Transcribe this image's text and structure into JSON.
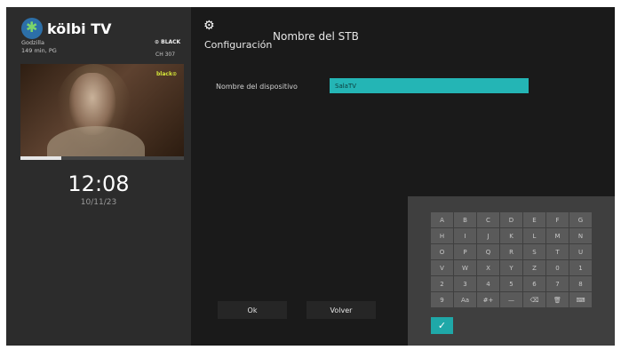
{
  "colors": {
    "accent": "#24b5b5",
    "panel": "#2c2c2c",
    "background": "#1a1a1a"
  },
  "brand": {
    "logo_text": "kölbi TV",
    "logo_icon": "kolbi-logo-icon"
  },
  "now_playing": {
    "program": "Godzilla",
    "meta": "149 min, PG",
    "channel_logo": "⊙ BLACK",
    "channel_number": "CH 307",
    "video_badge": "black⊙",
    "progress": 0.25
  },
  "clock": {
    "time": "12:08",
    "date": "10/11/23"
  },
  "header": {
    "section": "Configuración",
    "title": "Nombre del STB",
    "icon": "gear-icon"
  },
  "form": {
    "label": "Nombre del dispositivo",
    "value": "SalaTV"
  },
  "buttons": {
    "ok": "Ok",
    "back": "Volver"
  },
  "keyboard": {
    "keys": [
      "A",
      "B",
      "C",
      "D",
      "E",
      "F",
      "G",
      "H",
      "I",
      "J",
      "K",
      "L",
      "M",
      "N",
      "O",
      "P",
      "Q",
      "R",
      "S",
      "T",
      "U",
      "V",
      "W",
      "X",
      "Y",
      "Z",
      "0",
      "1",
      "2",
      "3",
      "4",
      "5",
      "6",
      "7",
      "8",
      "9",
      "Aa",
      "#+",
      "—",
      "⌫",
      "🗑",
      "⌨"
    ],
    "confirm": "✓"
  }
}
